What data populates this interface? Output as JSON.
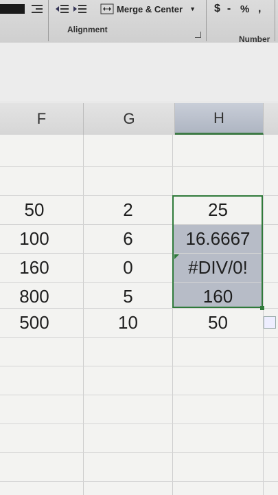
{
  "ribbon": {
    "merge_center_label": "Merge & Center",
    "dollar": "$",
    "dash": "-",
    "percent": "%",
    "comma": ",",
    "alignment_label": "Alignment",
    "number_label": "Number"
  },
  "columns": [
    "F",
    "G",
    "H"
  ],
  "rows": [
    {
      "F": "50",
      "G": "2",
      "H": "25"
    },
    {
      "F": "100",
      "G": "6",
      "H": "16.6667"
    },
    {
      "F": "160",
      "G": "0",
      "H": "#DIV/0!"
    },
    {
      "F": "800",
      "G": "5",
      "H": "160"
    },
    {
      "F": "500",
      "G": "10",
      "H": "50"
    }
  ],
  "colors": {
    "selection_border": "#2f7a3a",
    "selection_fill": "#b7bcc7"
  }
}
